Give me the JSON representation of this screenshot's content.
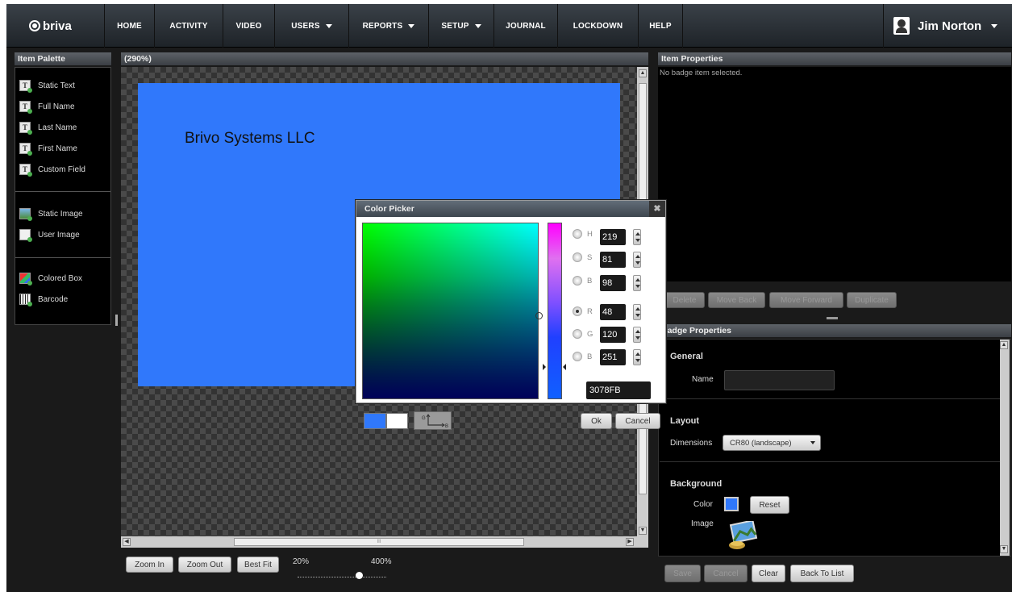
{
  "nav": {
    "logo": "briva",
    "items": [
      {
        "label": "HOME",
        "dropdown": false
      },
      {
        "label": "ACTIVITY",
        "dropdown": false
      },
      {
        "label": "VIDEO",
        "dropdown": false
      },
      {
        "label": "USERS",
        "dropdown": true
      },
      {
        "label": "REPORTS",
        "dropdown": true
      },
      {
        "label": "SETUP",
        "dropdown": true
      },
      {
        "label": "JOURNAL",
        "dropdown": false
      },
      {
        "label": "LOCKDOWN",
        "dropdown": false
      },
      {
        "label": "HELP",
        "dropdown": false
      }
    ],
    "user_name": "Jim Norton"
  },
  "palette": {
    "title": "Item Palette",
    "items": [
      "Static Text",
      "Full Name",
      "Last Name",
      "First Name",
      "Custom Field",
      "Static Image",
      "User Image",
      "Colored Box",
      "Barcode"
    ]
  },
  "canvas": {
    "zoom_label": "(290%)",
    "badge_text": "Brivo Systems LLC",
    "badge_color": "#3078FB",
    "hscroll_glyph": "III"
  },
  "zoom": {
    "zoom_in": "Zoom In",
    "zoom_out": "Zoom Out",
    "best_fit": "Best Fit",
    "min_label": "20%",
    "max_label": "400%"
  },
  "item_properties": {
    "title": "Item Properties",
    "empty_text": "No badge item selected.",
    "buttons": [
      "Delete",
      "Move Back",
      "Move Forward",
      "Duplicate"
    ]
  },
  "color_picker": {
    "title": "Color Picker",
    "close": "✖",
    "fields": [
      {
        "label": "H",
        "value": "219",
        "selected": false
      },
      {
        "label": "S",
        "value": "81",
        "selected": false
      },
      {
        "label": "B",
        "value": "98",
        "selected": false
      },
      {
        "label": "R",
        "value": "48",
        "selected": true
      },
      {
        "label": "G",
        "value": "120",
        "selected": false
      },
      {
        "label": "B",
        "value": "251",
        "selected": false
      }
    ],
    "hex": "3078FB",
    "ok": "Ok",
    "cancel": "Cancel",
    "swap_g": "G",
    "swap_b": "B"
  },
  "badge_properties": {
    "title": "Badge Properties",
    "general": "General",
    "name_label": "Name",
    "layout": "Layout",
    "dimensions_label": "Dimensions",
    "dimensions_value": "CR80 (landscape)",
    "background": "Background",
    "color_label": "Color",
    "reset": "Reset",
    "image_label": "Image"
  },
  "footer_buttons": {
    "save": "Save",
    "cancel": "Cancel",
    "clear": "Clear",
    "back_to_list": "Back To List"
  },
  "colors": {
    "badge_blue": "#3078FB",
    "panel_black": "#000000",
    "header_gray": "#4a5056"
  }
}
